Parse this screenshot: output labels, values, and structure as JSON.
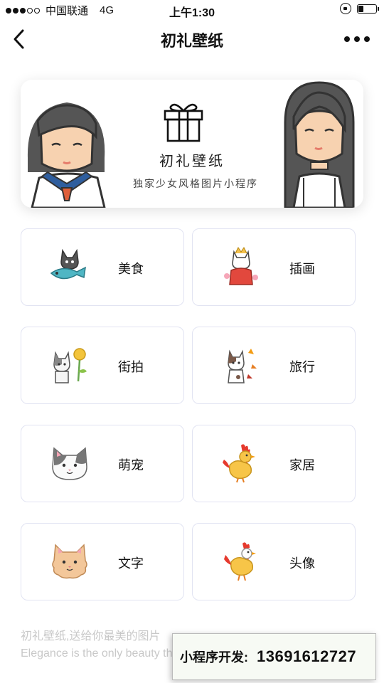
{
  "status_bar": {
    "carrier": "中国联通",
    "network": "4G",
    "time": "上午1:30",
    "battery_level": 0.25
  },
  "nav": {
    "title": "初礼壁纸",
    "back_icon": "chevron-left-icon",
    "more_icon": "more-dots-icon"
  },
  "banner": {
    "title": "初礼壁纸",
    "subtitle": "独家少女风格图片小程序",
    "gift_icon": "gift-icon"
  },
  "categories": [
    {
      "label": "美食",
      "icon": "cat-with-fish-icon"
    },
    {
      "label": "插画",
      "icon": "cat-in-kimono-icon"
    },
    {
      "label": "街拍",
      "icon": "cat-with-flower-icon"
    },
    {
      "label": "旅行",
      "icon": "cat-with-leaves-icon"
    },
    {
      "label": "萌宠",
      "icon": "cat-face-icon"
    },
    {
      "label": "家居",
      "icon": "rooster-icon"
    },
    {
      "label": "文字",
      "icon": "fluffy-cat-icon"
    },
    {
      "label": "头像",
      "icon": "chicken-icon"
    }
  ],
  "footer": {
    "tagline_cn": "初礼壁纸,送给你最美的图片",
    "tagline_en": "Elegance is the only beauty that never fades"
  },
  "dev_badge": {
    "label": "小程序开发:",
    "phone": "13691612727"
  },
  "colors": {
    "card_border": "#e1e3f2",
    "footer_text": "#c8c8c8",
    "badge_bg": "#f7faf4"
  }
}
